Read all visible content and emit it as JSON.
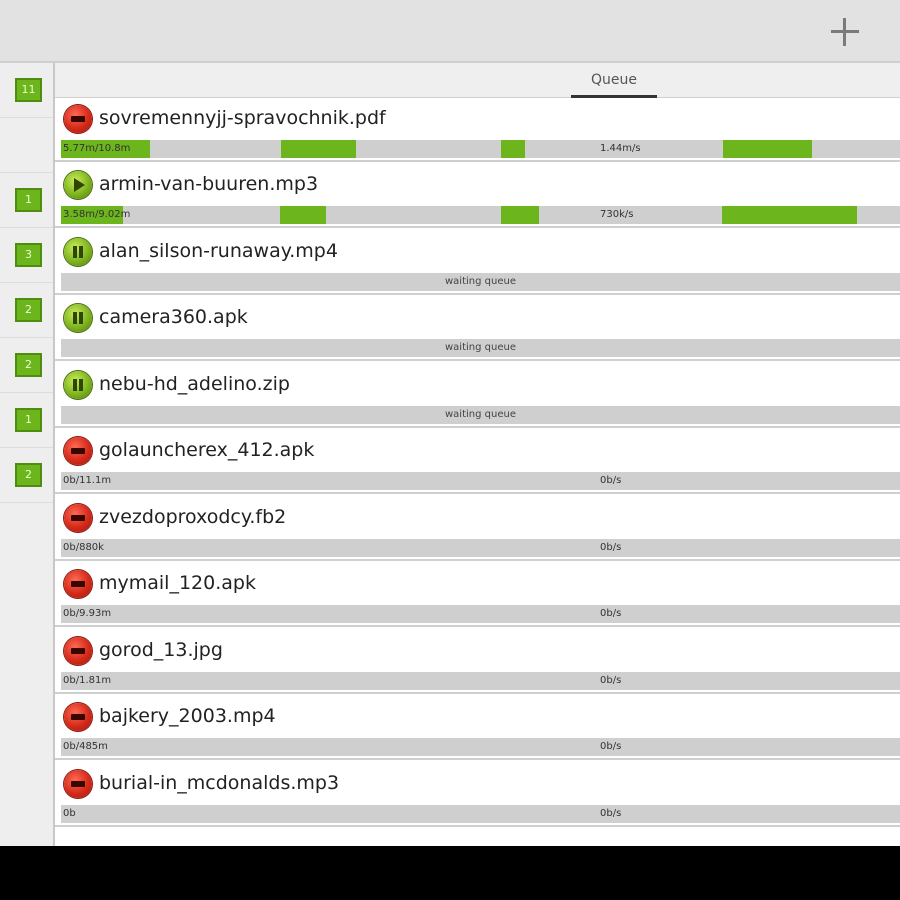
{
  "action_bar": {
    "add_icon": "plus-icon"
  },
  "tabs": {
    "queue_label": "Queue"
  },
  "sidebar": {
    "counts": [
      "11",
      "1",
      "3",
      "2",
      "2",
      "1",
      "2"
    ]
  },
  "downloads": [
    {
      "name": "sovremennyjj-spravochnik.pdf",
      "status": "stopped",
      "icon": "stop-icon",
      "progress_left": "5.77m/10.8m",
      "progress_mid": "1.44m/s",
      "progress_fraction": 0.53
    },
    {
      "name": "armin-van-buuren.mp3",
      "status": "playing",
      "icon": "play-icon",
      "progress_left": "3.58m/9.02m",
      "progress_mid": "730k/s",
      "progress_fraction": 0.4
    },
    {
      "name": "alan_silson-runaway.mp4",
      "status": "paused",
      "icon": "pause-icon",
      "progress_center": "waiting queue"
    },
    {
      "name": "camera360.apk",
      "status": "paused",
      "icon": "pause-icon",
      "progress_center": "waiting queue"
    },
    {
      "name": "nebu-hd_adelino.zip",
      "status": "paused",
      "icon": "pause-icon",
      "progress_center": "waiting queue"
    },
    {
      "name": "golauncherex_412.apk",
      "status": "stopped",
      "icon": "stop-icon",
      "progress_left": "0b/11.1m",
      "progress_mid": "0b/s"
    },
    {
      "name": "zvezdoproxodcy.fb2",
      "status": "stopped",
      "icon": "stop-icon",
      "progress_left": "0b/880k",
      "progress_mid": "0b/s"
    },
    {
      "name": "mymail_120.apk",
      "status": "stopped",
      "icon": "stop-icon",
      "progress_left": "0b/9.93m",
      "progress_mid": "0b/s"
    },
    {
      "name": "gorod_13.jpg",
      "status": "stopped",
      "icon": "stop-icon",
      "progress_left": "0b/1.81m",
      "progress_mid": "0b/s"
    },
    {
      "name": "bajkery_2003.mp4",
      "status": "stopped",
      "icon": "stop-icon",
      "progress_left": "0b/485m",
      "progress_mid": "0b/s"
    },
    {
      "name": "burial-in_mcdonalds.mp3",
      "status": "stopped",
      "icon": "stop-icon",
      "progress_left": "0b",
      "progress_mid": "0b/s"
    }
  ],
  "colors": {
    "accent_green": "#6cb51c",
    "stop_red": "#d42a1a",
    "track_gray": "#cfcfcf"
  }
}
